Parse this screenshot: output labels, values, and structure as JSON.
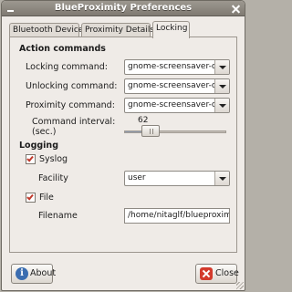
{
  "window": {
    "title": "BlueProximity Preferences"
  },
  "tabs": [
    {
      "label": "Bluetooth Device",
      "active": false
    },
    {
      "label": "Proximity Details",
      "active": false
    },
    {
      "label": "Locking",
      "active": true
    }
  ],
  "action_commands": {
    "heading": "Action commands",
    "locking": {
      "label": "Locking command:",
      "value": "gnome-screensaver-command -l"
    },
    "unlocking": {
      "label": "Unlocking command:",
      "value": "gnome-screensaver-command -d"
    },
    "proximity": {
      "label": "Proximity command:",
      "value": "gnome-screensaver-command -p"
    },
    "interval": {
      "label_line1": "Command interval:",
      "label_line2": "(sec.)",
      "value": "62",
      "fraction": 0.21
    }
  },
  "logging": {
    "heading": "Logging",
    "syslog": {
      "label": "Syslog",
      "checked": true
    },
    "facility": {
      "label": "Facility",
      "value": "user"
    },
    "file": {
      "label": "File",
      "checked": true
    },
    "filename": {
      "label": "Filename",
      "value": "/home/nitaglf/blueproximity"
    }
  },
  "buttons": {
    "about": "About",
    "close": "Close"
  },
  "colors": {
    "checkmark": "#c0392b",
    "about_icon": "#3b6db0",
    "close_icon": "#d33a2c"
  },
  "icons": {
    "about": "info-icon",
    "close": "close-icon",
    "dropdown": "chevron-down-icon"
  }
}
